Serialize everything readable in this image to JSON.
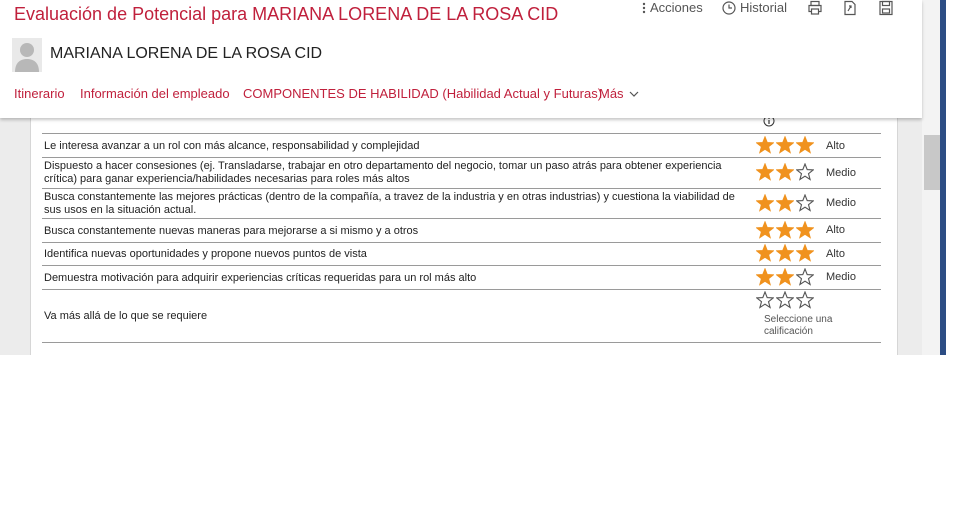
{
  "header": {
    "title": "Evaluación de Potencial para MARIANA LORENA DE LA ROSA CID",
    "actions_label": "Acciones",
    "history_label": "Historial",
    "employee_name": "MARIANA LORENA DE LA ROSA CID",
    "tabs": [
      {
        "label": "Itinerario"
      },
      {
        "label": "Información del empleado"
      },
      {
        "label": "COMPONENTES DE HABILIDAD (Habilidad Actual y Futuras)"
      },
      {
        "label": "Más"
      }
    ]
  },
  "colors": {
    "brand_red": "#c0203c",
    "star_filled": "#f0921e",
    "star_empty": "#555555"
  },
  "rows": [
    {
      "text": "Le interesa avanzar a un rol con más alcance, responsabilidad y complejidad",
      "stars": 3,
      "rating": "Alto"
    },
    {
      "text": "Dispuesto a hacer consesiones (ej. Transladarse, trabajar en otro departamento del negocio, tomar un paso atrás para obtener experiencia crítica) para ganar experiencia/habilidades necesarias para roles más altos",
      "stars": 2,
      "rating": "Medio"
    },
    {
      "text": "Busca constantemente las mejores prácticas (dentro de la compañía, a travez de la industria y en otras industrias) y cuestiona la viabilidad de sus usos en la situación actual.",
      "stars": 2,
      "rating": "Medio"
    },
    {
      "text": "Busca constantemente nuevas maneras para mejorarse a si mismo y a otros",
      "stars": 3,
      "rating": "Alto"
    },
    {
      "text": "Identifica nuevas oportunidades y propone nuevos puntos de vista",
      "stars": 3,
      "rating": "Alto"
    },
    {
      "text": "Demuestra motivación para adquirir experiencias críticas requeridas para un rol más alto",
      "stars": 2,
      "rating": "Medio"
    },
    {
      "text": "Va más allá de lo que se requiere",
      "stars": 0,
      "rating": "",
      "hint": "Seleccione una calificación"
    }
  ]
}
